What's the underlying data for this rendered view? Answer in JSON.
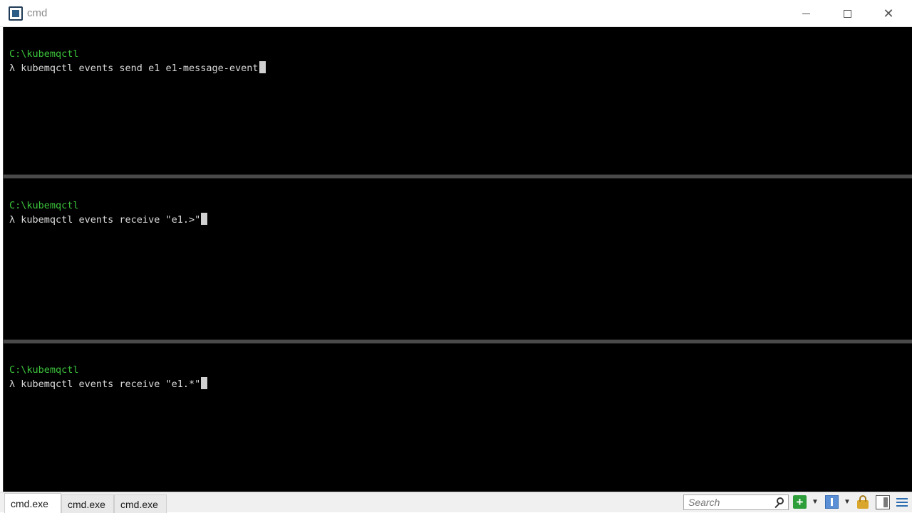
{
  "window": {
    "title": "cmd",
    "minimize_label": "",
    "maximize_label": "",
    "close_label": "✕"
  },
  "panes": [
    {
      "path": "C:\\kubemqctl",
      "command": "λ kubemqctl events send e1 e1-message-event"
    },
    {
      "path": "C:\\kubemqctl",
      "command": "λ kubemqctl events receive \"e1.>\""
    },
    {
      "path": "C:\\kubemqctl",
      "command": "λ kubemqctl events receive \"e1.*\""
    }
  ],
  "tabs": [
    {
      "label": "cmd.exe",
      "active": true
    },
    {
      "label": "cmd.exe",
      "active": false
    },
    {
      "label": "cmd.exe",
      "active": false
    }
  ],
  "toolbar": {
    "search_placeholder": "Search",
    "add_icon": "plus-icon",
    "dropdown_glyph": "▼",
    "panel_icon": "panel-icon",
    "lock_icon": "lock-icon",
    "split_icon": "split-view-icon",
    "menu_icon": "hamburger-menu-icon",
    "plus_glyph": "+"
  },
  "colors": {
    "terminal_bg": "#000000",
    "path_green": "#3cc43c",
    "command_text": "#d9d9d9",
    "splitter": "#4a4a4a"
  }
}
